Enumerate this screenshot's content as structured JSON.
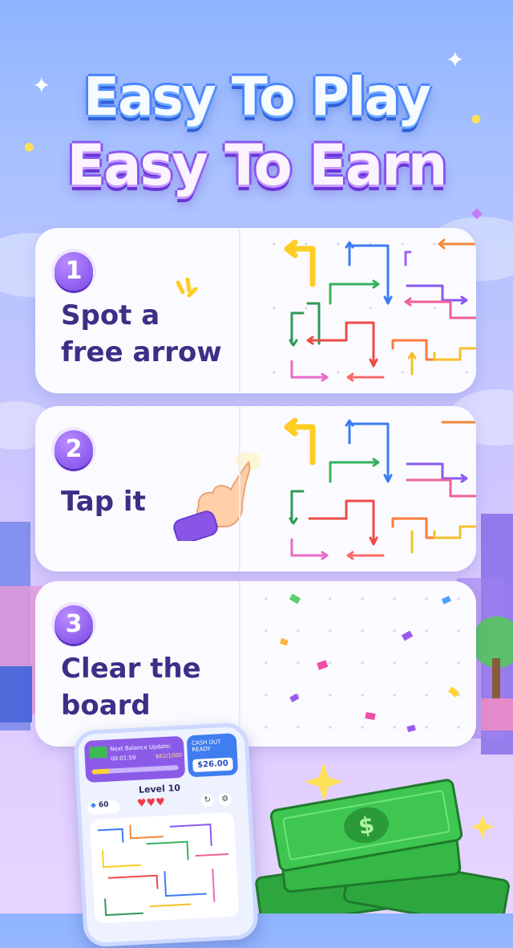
{
  "headline": {
    "line1": "Easy To Play",
    "line2": "Easy To Earn"
  },
  "steps": [
    {
      "number": "1",
      "lines": [
        "Spot a",
        "free arrow"
      ]
    },
    {
      "number": "2",
      "lines": [
        "Tap it"
      ]
    },
    {
      "number": "3",
      "lines": [
        "Clear the",
        "board"
      ]
    }
  ],
  "phone": {
    "balance_label": "Next Balance Update:",
    "timer": "00:01:59",
    "progress": "$62/1000",
    "cashout_label": "CASH OUT READY",
    "cashout_amount": "$26.00",
    "level": "Level 10",
    "gems": "60",
    "hearts": 3
  },
  "colors": {
    "accent": "#7a49e6",
    "text": "#3b2f86",
    "money": "#35b845"
  },
  "icons": [
    "hand-tap-icon",
    "dollar-bill-icon",
    "heart-icon",
    "gem-icon",
    "refresh-icon",
    "gear-icon",
    "sparkle-icon"
  ]
}
